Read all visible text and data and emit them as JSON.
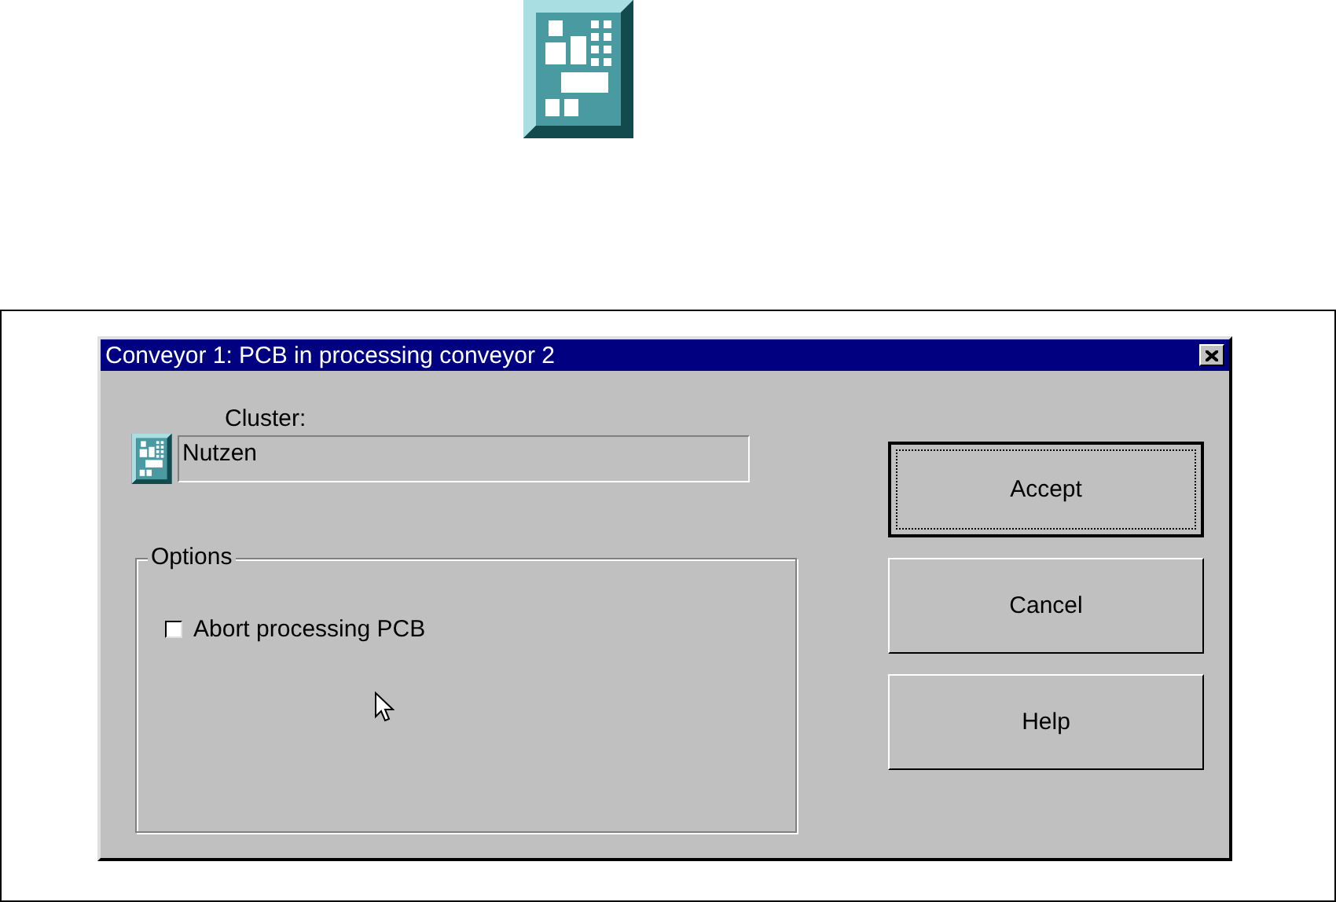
{
  "window": {
    "title": "Conveyor 1: PCB in processing conveyor 2"
  },
  "cluster": {
    "label": "Cluster:",
    "value": "Nutzen"
  },
  "options": {
    "title": "Options",
    "items": [
      {
        "label": "Abort processing PCB",
        "checked": false
      }
    ]
  },
  "buttons": [
    {
      "label": "Accept",
      "default": true
    },
    {
      "label": "Cancel",
      "default": false
    },
    {
      "label": "Help",
      "default": false
    }
  ]
}
